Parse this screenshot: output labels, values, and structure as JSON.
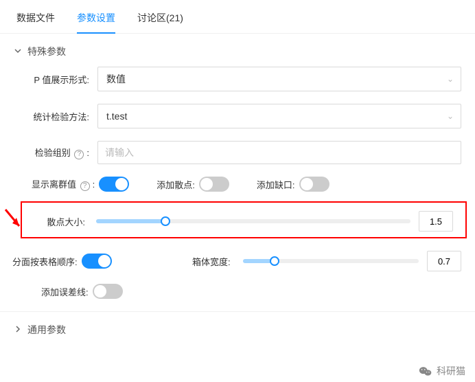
{
  "tabs": {
    "data_file": "数据文件",
    "params": "参数设置",
    "discussion": "讨论区(21)"
  },
  "sections": {
    "special": "特殊参数",
    "general": "通用参数"
  },
  "form": {
    "p_display_label": "P 值展示形式",
    "p_display_value": "数值",
    "stat_method_label": "统计检验方法",
    "stat_method_value": "t.test",
    "test_group_label": "检验组别",
    "test_group_placeholder": "请输入",
    "show_outliers": "显示离群值",
    "add_points": "添加散点",
    "add_notch": "添加缺口",
    "point_size_label": "散点大小",
    "point_size_value": "1.5",
    "facet_order": "分面按表格顺序",
    "box_width_label": "箱体宽度",
    "box_width_value": "0.7",
    "add_errorbar": "添加误差线",
    "colon": ":"
  },
  "sliders": {
    "point_size_percent": 22,
    "box_width_percent": 18
  },
  "watermark": "科研猫"
}
